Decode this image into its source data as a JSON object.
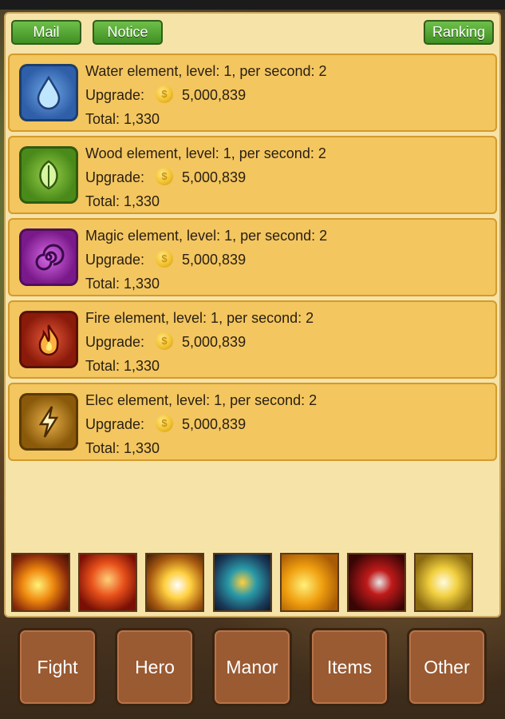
{
  "header": {
    "mail_label": "Mail",
    "notice_label": "Notice",
    "ranking_label": "Ranking"
  },
  "elements": [
    {
      "title": "Water element, level: 1, per second: 2",
      "upgrade_label": "Upgrade:",
      "upgrade_cost": "5,000,839",
      "total": "Total: 1,330",
      "icon": "water-drop-icon",
      "color": "#3a6fb8"
    },
    {
      "title": "Wood element, level: 1, per second: 2",
      "upgrade_label": "Upgrade:",
      "upgrade_cost": "5,000,839",
      "total": "Total: 1,330",
      "icon": "leaf-icon",
      "color": "#5a9a2a"
    },
    {
      "title": "Magic element, level: 1, per second: 2",
      "upgrade_label": "Upgrade:",
      "upgrade_cost": "5,000,839",
      "total": "Total: 1,330",
      "icon": "spiral-icon",
      "color": "#8a2a9a"
    },
    {
      "title": "Fire element, level: 1, per second: 2",
      "upgrade_label": "Upgrade:",
      "upgrade_cost": "5,000,839",
      "total": "Total: 1,330",
      "icon": "flame-icon",
      "color": "#b82a1a"
    },
    {
      "title": "Elec element, level: 1, per second: 2",
      "upgrade_label": "Upgrade:",
      "upgrade_cost": "5,000,839",
      "total": "Total: 1,330",
      "icon": "lightning-icon",
      "color": "#b8862a"
    }
  ],
  "skills": [
    {
      "icon": "fire-orb-skill-icon"
    },
    {
      "icon": "phoenix-skill-icon"
    },
    {
      "icon": "whirlwind-skill-icon"
    },
    {
      "icon": "shield-cross-skill-icon"
    },
    {
      "icon": "vortex-skill-icon"
    },
    {
      "icon": "blade-skill-icon"
    },
    {
      "icon": "holy-light-skill-icon"
    }
  ],
  "nav": {
    "fight": "Fight",
    "hero": "Hero",
    "manor": "Manor",
    "items": "Items",
    "other": "Other"
  }
}
